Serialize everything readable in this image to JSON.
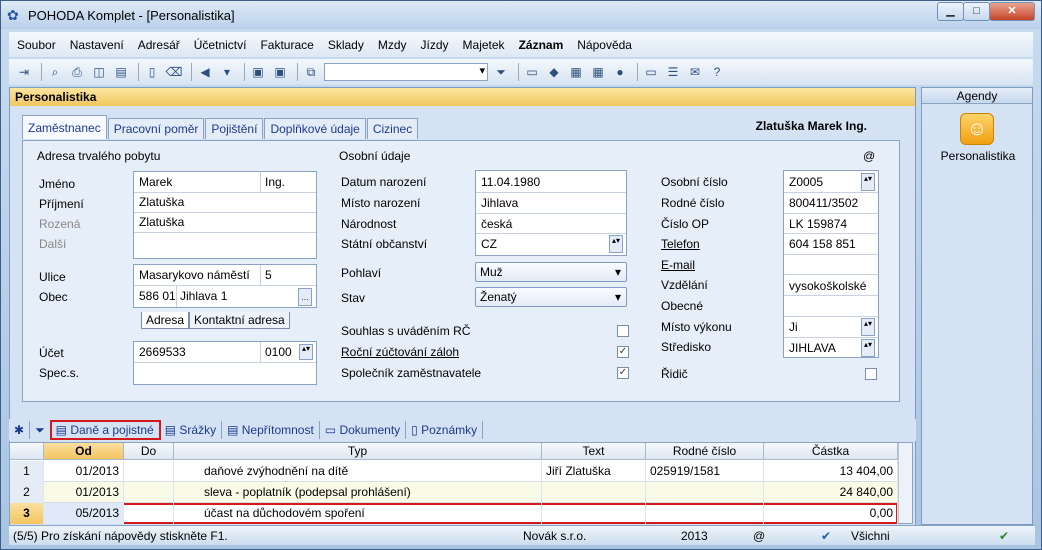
{
  "window": {
    "title": "POHODA Komplet - [Personalistika]"
  },
  "menu": [
    "Soubor",
    "Nastavení",
    "Adresář",
    "Účetnictví",
    "Fakturace",
    "Sklady",
    "Mzdy",
    "Jízdy",
    "Majetek",
    "Záznam",
    "Nápověda"
  ],
  "header": {
    "title": "Personalistika",
    "person": "Zlatuška Marek Ing."
  },
  "tabs": [
    "Zaměstnanec",
    "Pracovní poměr",
    "Pojištění",
    "Doplňkové údaje",
    "Cizinec"
  ],
  "address": {
    "section": "Adresa trvalého pobytu",
    "jmeno_lbl": "Jméno",
    "jmeno": "Marek",
    "titul": "Ing.",
    "prijmeni_lbl": "Příjmení",
    "prijmeni": "Zlatuška",
    "rozena_lbl": "Rozená",
    "rozena": "Zlatuška",
    "dalsi_lbl": "Další",
    "ulice_lbl": "Ulice",
    "ulice": "Masarykovo náměstí",
    "cp": "5",
    "obec_lbl": "Obec",
    "psc": "586 01",
    "obec": "Jihlava 1",
    "subtab1": "Adresa",
    "subtab2": "Kontaktní adresa",
    "ucet_lbl": "Účet",
    "ucet": "2669533",
    "kod": "0100",
    "spec_lbl": "Spec.s."
  },
  "osobni": {
    "section": "Osobní údaje",
    "at": "@",
    "datum_lbl": "Datum narození",
    "datum": "11.04.1980",
    "misto_lbl": "Místo narození",
    "misto": "Jihlava",
    "narodnost_lbl": "Národnost",
    "narodnost": "česká",
    "statni_lbl": "Státní občanství",
    "statni": "CZ",
    "pohlavi_lbl": "Pohlaví",
    "pohlavi": "Muž",
    "stav_lbl": "Stav",
    "stav": "Ženatý",
    "souhlas_lbl": "Souhlas s uváděním RČ",
    "rocni_lbl": "Roční zúčtování záloh",
    "spolecnik_lbl": "Společník zaměstnavatele"
  },
  "ident": {
    "oc_lbl": "Osobní číslo",
    "oc": "Z0005",
    "rc_lbl": "Rodné číslo",
    "rc": "800411/3502",
    "op_lbl": "Číslo OP",
    "op": "LK 159874",
    "tel_lbl": "Telefon",
    "tel": "604 158 851",
    "email_lbl": "E-mail",
    "vzd_lbl": "Vzdělání",
    "vzd": "vysokoškolské",
    "obecne_lbl": "Obecné",
    "mv_lbl": "Místo výkonu",
    "mv": "Ji",
    "str_lbl": "Středisko",
    "str": "JIHLAVA",
    "ridic_lbl": "Řidič"
  },
  "bottom_tabs": [
    "Daně a pojistné",
    "Srážky",
    "Nepřítomnost",
    "Dokumenty",
    "Poznámky"
  ],
  "grid": {
    "headers": [
      "Od",
      "Do",
      "Typ",
      "Text",
      "Rodné číslo",
      "Částka"
    ],
    "rows": [
      {
        "n": "1",
        "od": "01/2013",
        "do": "",
        "typ": "daňové zvýhodnění na dítě",
        "text": "Jiří Zlatuška",
        "rc": "025919/1581",
        "castka": "13 404,00"
      },
      {
        "n": "2",
        "od": "01/2013",
        "do": "",
        "typ": "sleva - poplatník (podepsal prohlášení)",
        "text": "",
        "rc": "",
        "castka": "24 840,00"
      },
      {
        "n": "3",
        "od": "05/2013",
        "do": "",
        "typ": "účast na důchodovém spoření",
        "text": "",
        "rc": "",
        "castka": "0,00"
      }
    ]
  },
  "status": {
    "help": "(5/5) Pro získání nápovědy stiskněte F1.",
    "company": "Novák s.r.o.",
    "year": "2013",
    "at": "@",
    "all": "Všichni"
  },
  "agendy": {
    "title": "Agendy",
    "item": "Personalistika"
  }
}
